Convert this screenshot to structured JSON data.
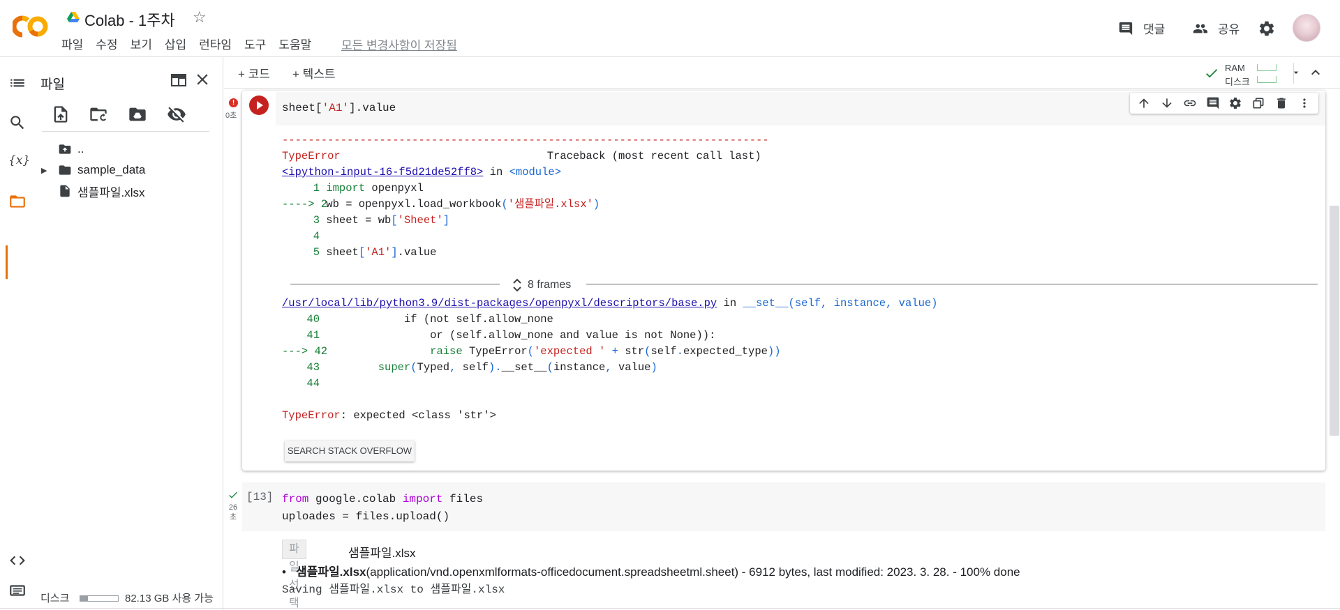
{
  "header": {
    "title": "Colab - 1주차",
    "menu": [
      "파일",
      "수정",
      "보기",
      "삽입",
      "런타임",
      "도구",
      "도움말"
    ],
    "saved_status": "모든 변경사항이 저장됨",
    "comment_label": "댓글",
    "share_label": "공유",
    "brand_color": "#f9ab00",
    "brand_color_2": "#e8710a"
  },
  "rail": {
    "icons": [
      "toc-icon",
      "search-icon",
      "variables-icon",
      "folder-icon",
      "code-snippets-icon",
      "terminal-icon"
    ],
    "active": "folder-icon"
  },
  "files_panel": {
    "title": "파일",
    "tree": [
      {
        "label": "..",
        "type": "parent-folder"
      },
      {
        "label": "sample_data",
        "type": "folder"
      },
      {
        "label": "샘플파일.xlsx",
        "type": "file"
      }
    ],
    "disk_label": "디스크",
    "disk_free": "82.13 GB 사용 가능",
    "disk_used_fraction": 0.2
  },
  "toolbar": {
    "add_code": "+ 코드",
    "add_text": "+ 텍스트",
    "ram_label": "RAM",
    "disk_label": "디스크"
  },
  "cell1": {
    "time": "0초",
    "source": "sheet['A1'].value",
    "error": {
      "dashes": "---------------------------------------------------------------------------",
      "type": "TypeError",
      "traceback_header": "Traceback (most recent call last)",
      "input_link": "<ipython-input-16-f5d21de52ff8>",
      "in_word": "in",
      "module": "<module>",
      "frame1_lines": [
        {
          "no": "1",
          "arrow": "",
          "code": "import openpyxl"
        },
        {
          "no": "2",
          "arrow": "----> ",
          "code": "wb = openpyxl.load_workbook('샘플파일.xlsx')"
        },
        {
          "no": "3",
          "arrow": "",
          "code": "sheet = wb['Sheet']"
        },
        {
          "no": "4",
          "arrow": "",
          "code": ""
        },
        {
          "no": "5",
          "arrow": "",
          "code": "sheet['A1'].value"
        }
      ],
      "frames_label": "8 frames",
      "file_link": "/usr/local/lib/python3.9/dist-packages/openpyxl/descriptors/base.py",
      "func_sig": "__set__(self, instance, value)",
      "frame2_lines": [
        {
          "no": "40",
          "arrow": "",
          "code": "            if (not self.allow_none"
        },
        {
          "no": "41",
          "arrow": "",
          "code": "                or (self.allow_none and value is not None)):"
        },
        {
          "no": "42",
          "arrow": "---> ",
          "code": "                raise TypeError('expected ' + str(self.expected_type))"
        },
        {
          "no": "43",
          "arrow": "",
          "code": "        super(Typed, self).__set__(instance, value)"
        },
        {
          "no": "44",
          "arrow": "",
          "code": ""
        }
      ],
      "final_type": "TypeError",
      "final_msg": ": expected <class 'str'>"
    },
    "so_button": "SEARCH STACK OVERFLOW"
  },
  "cell2": {
    "exec_count": "[13]",
    "time": "26\n초",
    "source_lines": [
      "from google.colab import files",
      "uploades = files.upload()"
    ],
    "file_button": "파일 선택",
    "chosen_file": "샘플파일.xlsx",
    "upload_name": "샘플파일.xlsx",
    "upload_detail": "(application/vnd.openxmlformats-officedocument.spreadsheetml.sheet) - 6912 bytes, last modified: 2023. 3. 28. - 100% done",
    "saving_msg": "Saving 샘플파일.xlsx to 샘플파일.xlsx"
  }
}
